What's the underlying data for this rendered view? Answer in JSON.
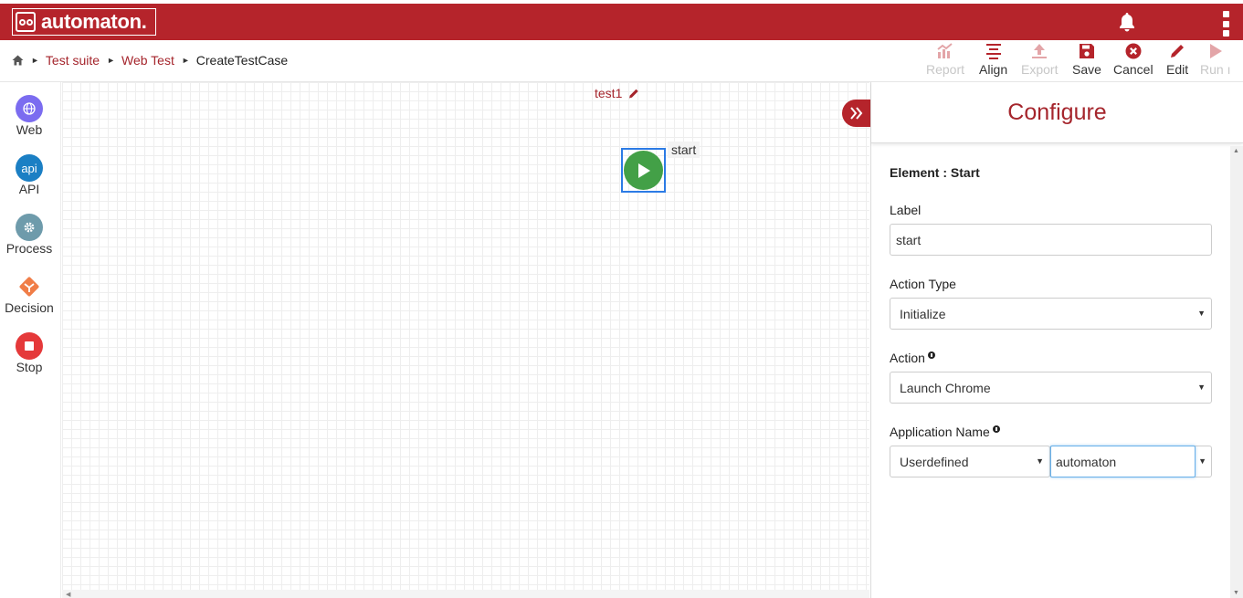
{
  "app": {
    "logo_text": "automaton."
  },
  "breadcrumb": {
    "items": [
      "Test suite",
      "Web Test"
    ],
    "current": "CreateTestCase"
  },
  "toolbar": {
    "report": "Report",
    "align": "Align",
    "export": "Export",
    "save": "Save",
    "cancel": "Cancel",
    "edit": "Edit",
    "run": "Run ı"
  },
  "palette": {
    "web": "Web",
    "api_icon": "api",
    "api": "API",
    "process": "Process",
    "decision": "Decision",
    "stop": "Stop"
  },
  "canvas": {
    "test_name": "test1",
    "node_label": "start"
  },
  "panel": {
    "title": "Configure",
    "element": "Element : Start",
    "label_title": "Label",
    "label_value": "start",
    "action_type_title": "Action Type",
    "action_type_value": "Initialize",
    "action_title": "Action",
    "action_value": "Launch Chrome",
    "app_name_title": "Application Name",
    "app_name_type": "Userdefined",
    "app_name_value": "automaton"
  },
  "colors": {
    "brand": "#b5242b",
    "link": "#a5252c",
    "start_green": "#43a047",
    "selection": "#2c7be5"
  }
}
